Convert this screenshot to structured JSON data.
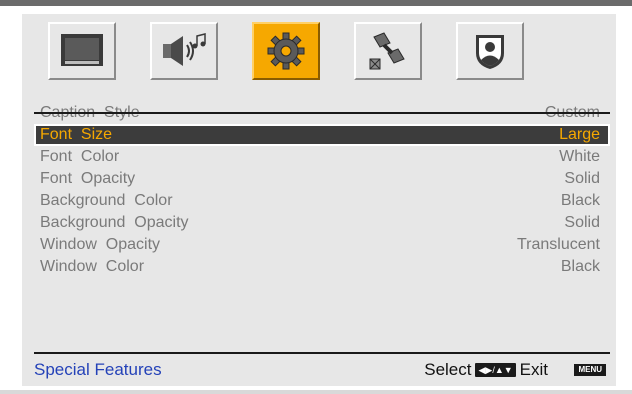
{
  "tabs": [
    {
      "name": "picture",
      "icon": "tv-icon"
    },
    {
      "name": "audio",
      "icon": "speaker-music-icon"
    },
    {
      "name": "setup",
      "icon": "gear-icon",
      "active": true
    },
    {
      "name": "channel",
      "icon": "satellite-icon"
    },
    {
      "name": "lock",
      "icon": "parental-lock-icon"
    }
  ],
  "rows": [
    {
      "label": "Caption  Style",
      "value": "Custom"
    },
    {
      "label": "Font  Size",
      "value": "Large",
      "selected": true
    },
    {
      "label": "Font  Color",
      "value": "White"
    },
    {
      "label": "Font  Opacity",
      "value": "Solid"
    },
    {
      "label": "Background  Color",
      "value": "Black"
    },
    {
      "label": "Background  Opacity",
      "value": "Solid"
    },
    {
      "label": "Window  Opacity",
      "value": "Translucent"
    },
    {
      "label": "Window  Color",
      "value": "Black"
    }
  ],
  "footer": {
    "title": "Special  Features",
    "select_label": "Select",
    "exit_label": "Exit",
    "menu_key": "MENU"
  },
  "colors": {
    "accent": "#f6a800",
    "selected_bg": "#3c3c3c",
    "footer_title": "#2442b8",
    "text": "#7a7a7a"
  }
}
